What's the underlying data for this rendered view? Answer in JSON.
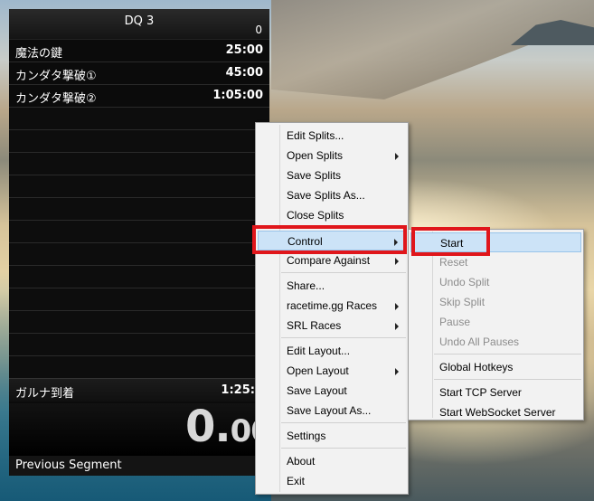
{
  "livesplit": {
    "title": "DQ 3",
    "attempts": "0",
    "splits": [
      {
        "name": "魔法の鍵",
        "time": "25:00"
      },
      {
        "name": "カンダタ撃破①",
        "time": "45:00"
      },
      {
        "name": "カンダタ撃破②",
        "time": "1:05:00"
      }
    ],
    "last_split": {
      "name": "ガルナ到着",
      "time": "1:25:0"
    },
    "timer": {
      "main": "0.",
      "fraction": "00"
    },
    "previous_segment": "Previous Segment"
  },
  "context_menu": {
    "items": [
      {
        "label": "Edit Splits...",
        "submenu": false
      },
      {
        "label": "Open Splits",
        "submenu": true
      },
      {
        "label": "Save Splits",
        "submenu": false
      },
      {
        "label": "Save Splits As...",
        "submenu": false
      },
      {
        "label": "Close Splits",
        "submenu": false
      },
      {
        "label": "Control",
        "submenu": true,
        "highlighted": true
      },
      {
        "label": "Compare Against",
        "submenu": true
      },
      {
        "label": "Share...",
        "submenu": false
      },
      {
        "label": "racetime.gg Races",
        "submenu": true
      },
      {
        "label": "SRL Races",
        "submenu": true
      },
      {
        "label": "Edit Layout...",
        "submenu": false
      },
      {
        "label": "Open Layout",
        "submenu": true
      },
      {
        "label": "Save Layout",
        "submenu": false
      },
      {
        "label": "Save Layout As...",
        "submenu": false
      },
      {
        "label": "Settings",
        "submenu": false
      },
      {
        "label": "About",
        "submenu": false
      },
      {
        "label": "Exit",
        "submenu": false
      }
    ]
  },
  "control_submenu": {
    "items": [
      {
        "label": "Start",
        "enabled": true,
        "highlighted": true
      },
      {
        "label": "Reset",
        "enabled": false
      },
      {
        "label": "Undo Split",
        "enabled": false
      },
      {
        "label": "Skip Split",
        "enabled": false
      },
      {
        "label": "Pause",
        "enabled": false
      },
      {
        "label": "Undo All Pauses",
        "enabled": false
      },
      {
        "label": "Global Hotkeys",
        "enabled": true
      },
      {
        "label": "Start TCP Server",
        "enabled": true
      },
      {
        "label": "Start WebSocket Server",
        "enabled": true
      }
    ]
  },
  "colors": {
    "highlight_box": "#e0161b",
    "menu_hover": "#cce3f7"
  }
}
